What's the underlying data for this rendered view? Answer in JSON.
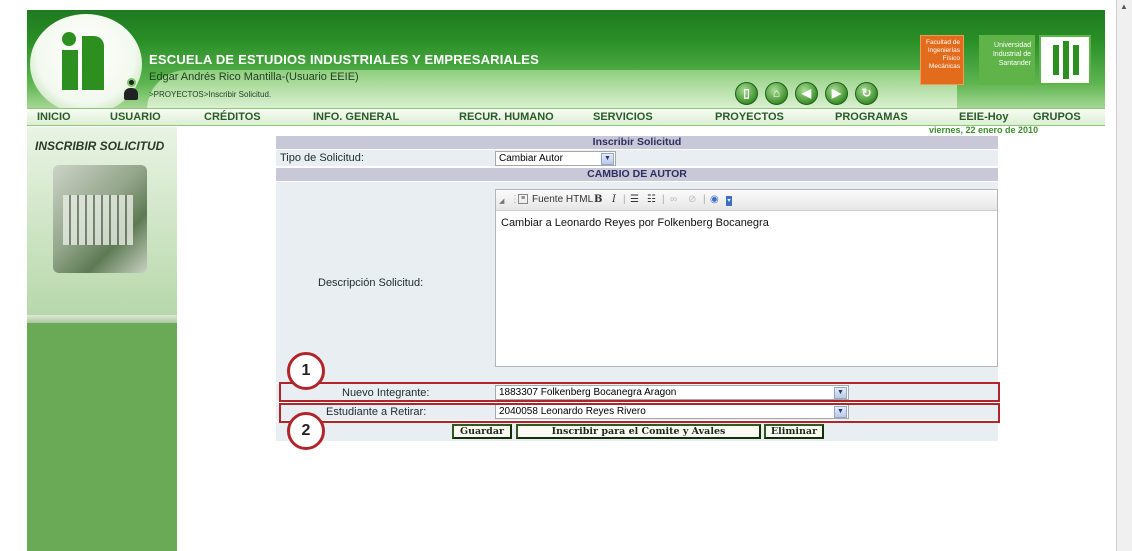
{
  "header": {
    "school_title": "ESCUELA DE ESTUDIOS INDUSTRIALES Y EMPRESARIALES",
    "user_name": "Edgar Andrés Rico Mantilla-(Usuario EEIE)",
    "breadcrumb": ">PROYECTOS>Inscribir Solicitud.",
    "faculty_logo_text": "Facultad de Ingenierías Físico Mecánicas",
    "uis_text": "Universidad Industrial de Santander",
    "nav_icons": [
      "door-icon",
      "home-icon",
      "back-icon",
      "forward-icon",
      "refresh-icon"
    ]
  },
  "menu": {
    "items": [
      "INICIO",
      "USUARIO",
      "CRÉDITOS",
      "INFO. GENERAL",
      "RECUR. HUMANO",
      "SERVICIOS",
      "PROYECTOS",
      "PROGRAMAS",
      "EEIE-Hoy",
      "GRUPOS"
    ],
    "date": "viernes, 22 enero de 2010"
  },
  "sidebar": {
    "title": "INSCRIBIR SOLICITUD"
  },
  "form": {
    "header": "Inscribir Solicitud",
    "tipo_label": "Tipo de Solicitud:",
    "tipo_value": "Cambiar Autor",
    "section_header": "CAMBIO DE AUTOR",
    "descripcion_label": "Descripción Solicitud:",
    "toolbar_fuente": "Fuente HTML",
    "descripcion_text": "Cambiar a Leonardo Reyes por Folkenberg Bocanegra",
    "nuevo_label": "Nuevo Integrante:",
    "nuevo_value": "1883307 Folkenberg Bocanegra Aragon",
    "retirar_label": "Estudiante a Retirar:",
    "retirar_value": "2040058 Leonardo Reyes Rivero",
    "buttons": {
      "guardar": "Guardar",
      "inscribir": "Inscribir para el Comite y Avales",
      "eliminar": "Eliminar"
    }
  },
  "annotations": [
    "1",
    "2"
  ],
  "colors": {
    "brand_green": "#2a8f27",
    "highlight_red": "#b0252a",
    "form_header": "#c8c8d8"
  }
}
